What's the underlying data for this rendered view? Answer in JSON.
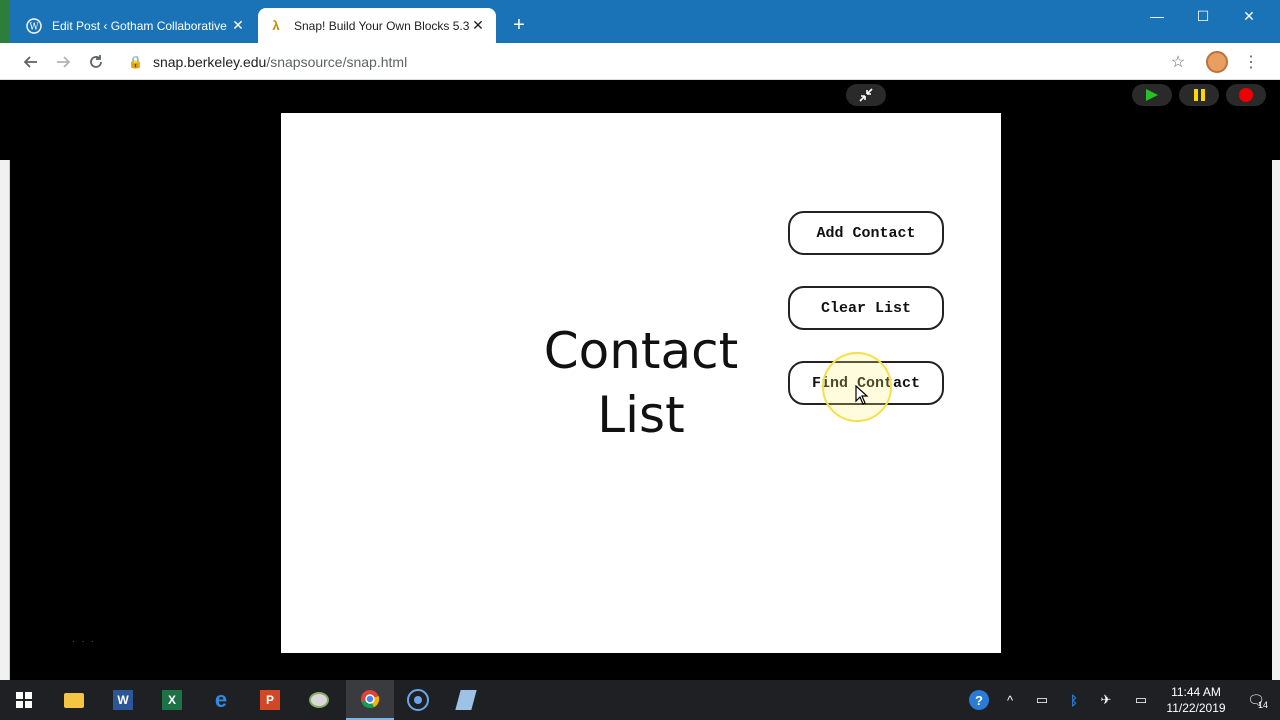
{
  "browser": {
    "tabs": [
      {
        "title": "Edit Post ‹ Gotham Collaborative",
        "favicon": "wordpress-icon"
      },
      {
        "title": "Snap! Build Your Own Blocks 5.3.",
        "favicon": "lambda-icon"
      }
    ],
    "url_host": "snap.berkeley.edu",
    "url_path": "/snapsource/snap.html"
  },
  "snap": {
    "stage_title_line1": "Contact",
    "stage_title_line2": "List",
    "buttons": [
      {
        "label": "Add Contact"
      },
      {
        "label": "Clear List"
      },
      {
        "label": "Find Contact"
      }
    ]
  },
  "taskbar": {
    "time": "11:44 AM",
    "date": "11/22/2019",
    "notification_count": "14"
  }
}
